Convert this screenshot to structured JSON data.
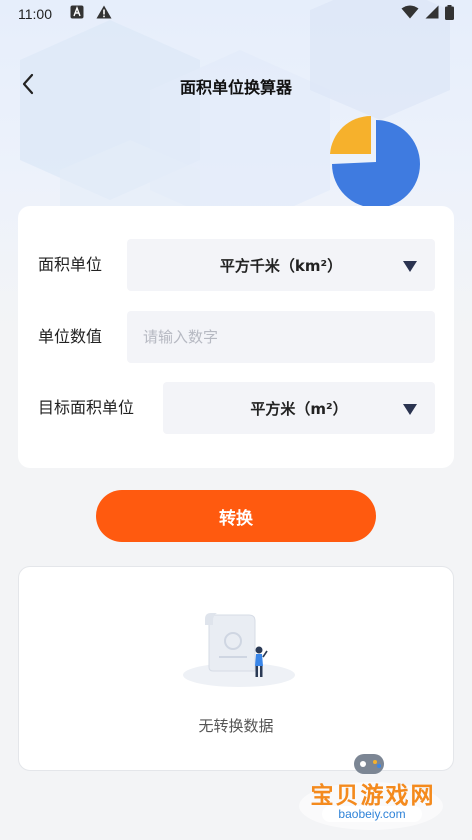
{
  "status_bar": {
    "time": "11:00",
    "left_icons": [
      "a-notification-icon",
      "warning-icon"
    ],
    "right_icons": [
      "wifi-icon",
      "signal-icon",
      "battery-icon"
    ]
  },
  "nav": {
    "back_icon": "chevron-left-icon",
    "title": "面积单位换算器"
  },
  "form": {
    "source_unit": {
      "label": "面积单位",
      "value": "平方千米（km²）"
    },
    "amount": {
      "label": "单位数值",
      "value": "",
      "placeholder": "请输入数字"
    },
    "target_unit": {
      "label": "目标面积单位",
      "value": "平方米（m²）"
    }
  },
  "convert_button": {
    "label": "转换"
  },
  "result": {
    "empty_text": "无转换数据",
    "illustration": "empty-document-person-illustration"
  },
  "watermark": {
    "text": "宝贝游戏网",
    "url": "baobeiy.com"
  },
  "colors": {
    "accent": "#ff5a0f",
    "pie_blue": "#3f7be0",
    "pie_yellow": "#f6b12c",
    "field_bg": "#f3f4f8"
  }
}
